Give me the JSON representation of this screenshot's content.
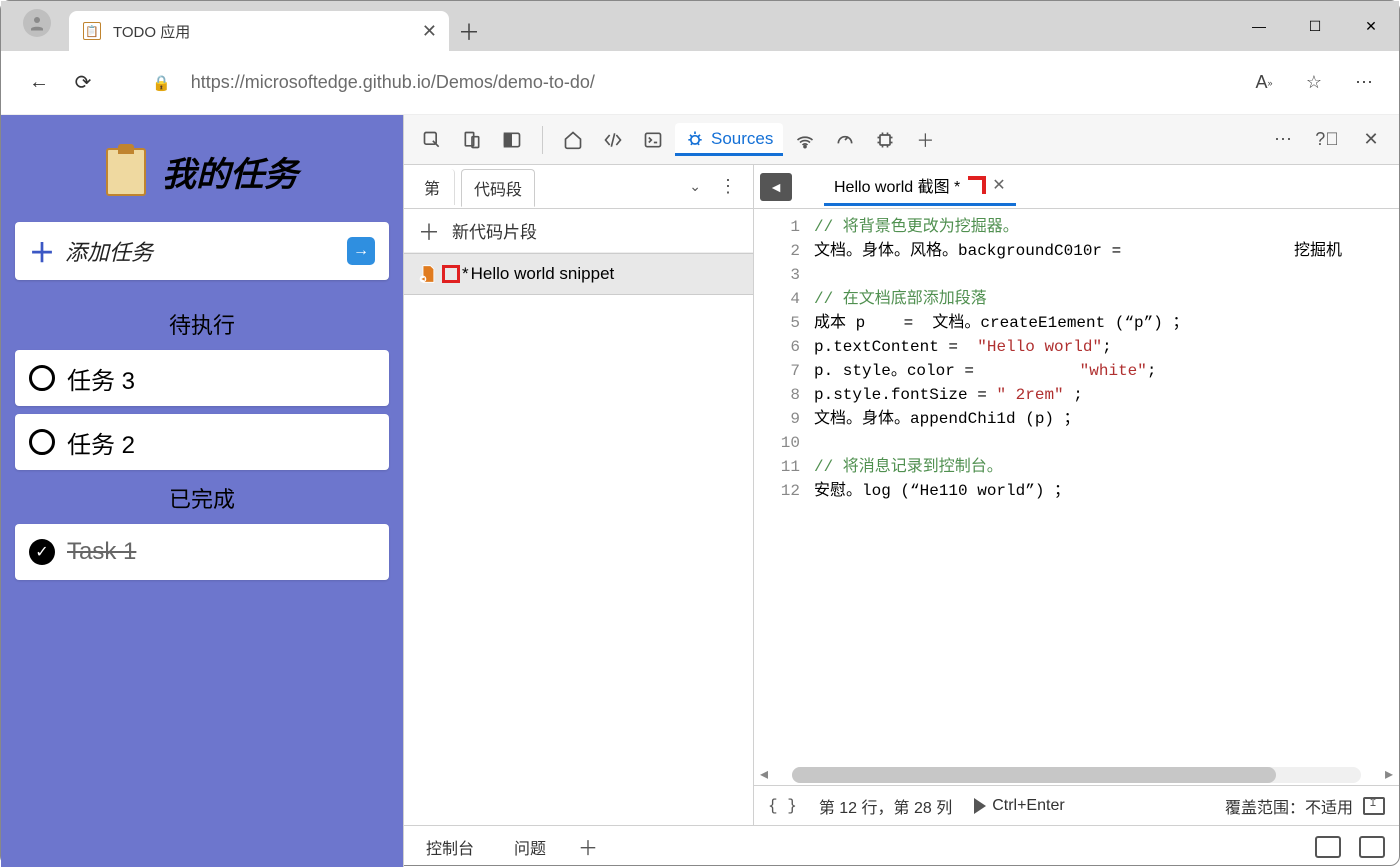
{
  "browser": {
    "tab_title": "TODO 应用",
    "url": "https://microsoftedge.github.io/Demos/demo-to-do/"
  },
  "todo": {
    "header": "我的任务",
    "add_label": "添加任务",
    "pending_label": "待执行",
    "done_label": "已完成",
    "pending": [
      "任务 3",
      "任务 2"
    ],
    "completed": [
      "Task 1"
    ]
  },
  "devtools": {
    "sources_label": "Sources",
    "left": {
      "tab_page": "第",
      "tab_snippets": "代码段",
      "new_snippet": "新代码片段",
      "selected_snippet_star": "*",
      "selected_snippet_name": "Hello world snippet"
    },
    "editor": {
      "open_tab": "Hello world 截图 *",
      "lines": [
        {
          "n": 1,
          "t": "// 将背景色更改为挖掘器。",
          "c": "cm-comment"
        },
        {
          "n": 2,
          "t": "文档。身体。风格。backgroundC010r =                  挖掘机"
        },
        {
          "n": 3,
          "t": ""
        },
        {
          "n": 4,
          "t": "// 在文档底部添加段落",
          "c": "cm-comment"
        },
        {
          "n": 5,
          "t": "成本 p    =  文档。createE1ement (“p”) ；"
        },
        {
          "n": 6,
          "t": "p.textContent =  \"Hello world\";",
          "s": true
        },
        {
          "n": 7,
          "t": "p. style。color =           \"white\";",
          "s": true
        },
        {
          "n": 8,
          "t": "p.style.fontSize = \" 2rem\" ;",
          "s": true
        },
        {
          "n": 9,
          "t": "文档。身体。appendChi1d (p) ；"
        },
        {
          "n": 10,
          "t": ""
        },
        {
          "n": 11,
          "t": "// 将消息记录到控制台。",
          "c": "cm-comment"
        },
        {
          "n": 12,
          "t": "安慰。log (“He110 world”) ；"
        }
      ],
      "cursor_info": "第 12 行，第 28 列",
      "run_hint": "Ctrl+Enter",
      "coverage": "覆盖范围：不适用"
    },
    "footer": {
      "console": "控制台",
      "issues": "问题"
    }
  }
}
